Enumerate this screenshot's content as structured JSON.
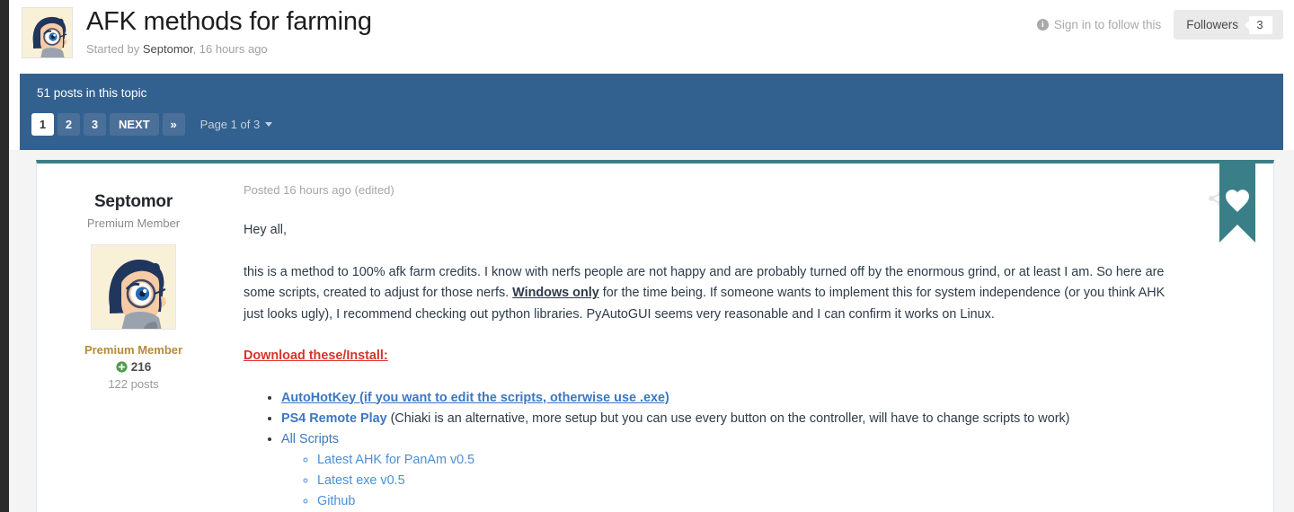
{
  "header": {
    "title": "AFK methods for farming",
    "started_by_prefix": "Started by ",
    "starter": "Septomor",
    "started_time": ", 16 hours ago",
    "avatar_icon": "user-avatar-anime",
    "sign_in_to_follow": "Sign in to follow this",
    "info_icon": "info-icon",
    "followers_label": "Followers",
    "followers_count": "3"
  },
  "topic_bar": {
    "posts_in_topic": "51 posts in this topic",
    "pages": [
      "1",
      "2",
      "3"
    ],
    "next_label": "NEXT",
    "last_label": "»",
    "page_of": "Page 1 of 3",
    "caret_icon": "chevron-down-icon",
    "accent_color": "#33618f"
  },
  "post": {
    "author": {
      "name": "Septomor",
      "rank": "Premium Member",
      "group": "Premium Member",
      "reputation": "216",
      "reputation_icon": "plus-circle-icon",
      "posts": "122 posts",
      "avatar_icon": "user-avatar-anime"
    },
    "posted_meta": "Posted 16 hours ago (edited)",
    "greeting": "Hey all,",
    "intro_part1": "this is a method to 100% afk farm credits. I know with nerfs people are not happy and are probably turned off by the enormous grind, or at least I am. So here are some scripts, created to adjust for those nerfs. ",
    "intro_bold": "Windows only",
    "intro_part2": " for the time being. If someone wants to implement this for system independence (or you think AHK just looks ugly), I recommend checking out python libraries. PyAutoGUI seems very reasonable and I can confirm it works on Linux.",
    "download_heading": "Download these/Install:",
    "links": {
      "autohotkey": "AutoHotKey (if you want to edit the scripts, otherwise use .exe)",
      "ps4_remote_play": "PS4 Remote Play",
      "ps4_note": " (Chiaki is an alternative, more setup but you can use every button on the controller, will have to change scripts to work)",
      "all_scripts": "All Scripts",
      "sub_links": [
        "Latest AHK for PanAm v0.5",
        "Latest exe v0.5",
        "Github"
      ]
    },
    "share_icon": "share-icon",
    "like_icon": "heart-icon",
    "ribbon_color": "#3a7f88",
    "heading_color": "#d8342a",
    "link_color": "#3d77c2"
  }
}
